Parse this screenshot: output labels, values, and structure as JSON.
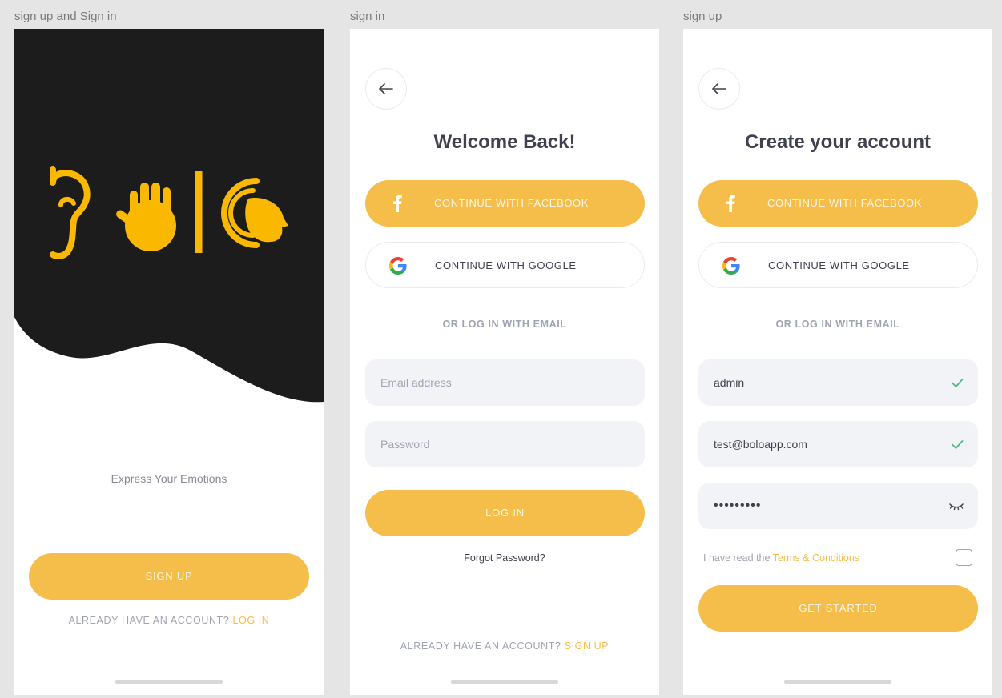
{
  "frames": {
    "splash_label": "sign up and Sign in",
    "signin_label": "sign in",
    "signup_label": "sign up"
  },
  "splash": {
    "tagline": "Express Your Emotions",
    "signup_button": "SIGN UP",
    "footer_prefix": "ALREADY HAVE AN ACCOUNT?",
    "footer_link": "LOG IN"
  },
  "signin": {
    "title": "Welcome Back!",
    "facebook_button": "CONTINUE WITH FACEBOOK",
    "google_button": "CONTINUE WITH GOOGLE",
    "divider": "OR LOG IN WITH EMAIL",
    "email_placeholder": "Email address",
    "password_placeholder": "Password",
    "login_button": "LOG IN",
    "forgot": "Forgot Password?",
    "footer_prefix": "ALREADY HAVE AN ACCOUNT?",
    "footer_link": "SIGN UP"
  },
  "signup": {
    "title": "Create your account",
    "facebook_button": "CONTINUE WITH FACEBOOK",
    "google_button": "CONTINUE WITH GOOGLE",
    "divider": "OR LOG IN WITH EMAIL",
    "username_value": "admin",
    "email_value": "test@boloapp.com",
    "password_value": "•••••••••",
    "terms_prefix": "I have read the",
    "terms_link": "Terms & Conditions",
    "terms_checked": false,
    "start_button": "GET STARTED"
  },
  "icons": {
    "back": "arrow-left-icon",
    "facebook": "facebook-icon",
    "google": "google-icon",
    "valid": "checkmark-icon",
    "hide_password": "eye-closed-icon"
  },
  "colors": {
    "accent": "#f5be4a",
    "dark_bg": "#1c1c1c",
    "logo": "#fbb800",
    "text_dark": "#3f414e",
    "text_muted": "#a1a4b2",
    "field_bg": "#f2f3f7",
    "valid": "#58b78a"
  }
}
